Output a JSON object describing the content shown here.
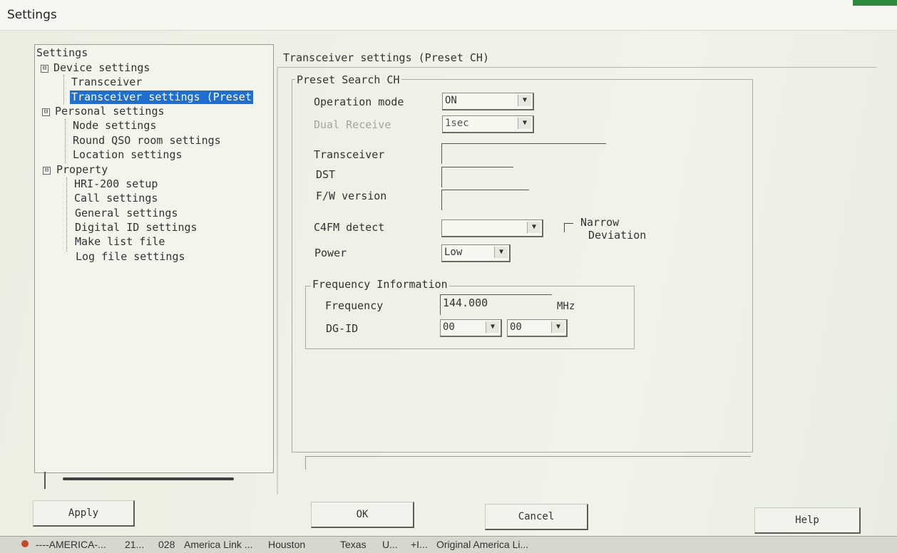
{
  "window": {
    "title": "Settings"
  },
  "tree": {
    "root": "Settings",
    "groups": [
      {
        "label": "Device settings",
        "expander": "⊟",
        "items": [
          "Transceiver",
          "Transceiver settings (Preset"
        ]
      },
      {
        "label": "Personal settings",
        "expander": "⊟",
        "items": [
          "Node settings",
          "Round QSO room settings",
          "Location settings"
        ]
      },
      {
        "label": "Property",
        "expander": "⊟",
        "items": [
          "HRI-200 setup",
          "Call settings",
          "General settings",
          "Digital ID settings",
          "Make list file",
          "Log file settings"
        ]
      }
    ],
    "selected": "Transceiver settings (Preset"
  },
  "pane": {
    "title": "Transceiver settings (Preset CH)",
    "preset_group": "Preset Search CH",
    "operation_mode": {
      "label": "Operation mode",
      "value": "ON"
    },
    "dual_receive": {
      "label": "Dual Receive",
      "value": "1sec"
    },
    "transceiver": {
      "label": "Transceiver",
      "value": ""
    },
    "dst": {
      "label": "DST",
      "value": ""
    },
    "fw_version": {
      "label": "F/W version",
      "value": ""
    },
    "c4fm_detect": {
      "label": "C4FM detect",
      "value": ""
    },
    "narrow": {
      "line1": "Narrow",
      "line2": "Deviation"
    },
    "power": {
      "label": "Power",
      "value": "Low"
    },
    "freq_group": "Frequency Information",
    "frequency": {
      "label": "Frequency",
      "value": "144.000",
      "unit": "MHz"
    },
    "dgid": {
      "label": "DG-ID",
      "value1": "00",
      "value2": "00"
    }
  },
  "buttons": {
    "apply": "Apply",
    "ok": "OK",
    "cancel": "Cancel",
    "help": "Help"
  },
  "status_bar": [
    "----AMERICA-...",
    "21...",
    "028",
    "America Link ...",
    "Houston",
    "Texas",
    "U...",
    "+I...",
    "Original America Li..."
  ],
  "colors": {
    "selection": "#1f6fd1",
    "background": "#eff1e6"
  }
}
